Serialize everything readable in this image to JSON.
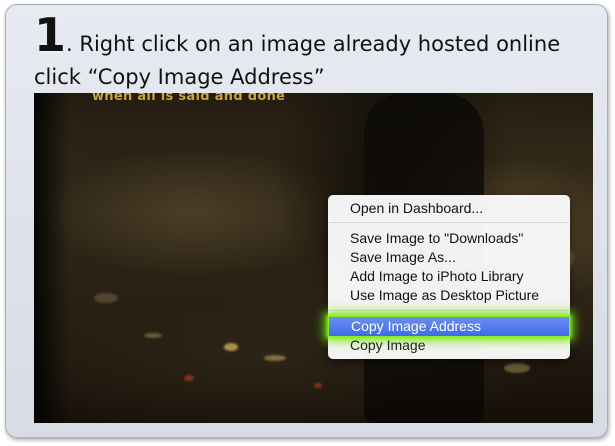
{
  "instruction": {
    "step_number": "1",
    "line1": ". Right click on an image already hosted online",
    "line2": "click “Copy Image Address”"
  },
  "photo": {
    "caption": "when all is said and done"
  },
  "context_menu": {
    "items": [
      {
        "label": "Open in Dashboard..."
      },
      {
        "label": "Save Image to \"Downloads\""
      },
      {
        "label": "Save Image As..."
      },
      {
        "label": "Add Image to iPhoto Library"
      },
      {
        "label": "Use Image as Desktop Picture"
      },
      {
        "label": "Copy Image Address"
      },
      {
        "label": "Copy Image"
      }
    ],
    "highlighted_item": "Copy Image Address",
    "highlight_color": "#3d6be6",
    "glow_color": "#7ce614"
  }
}
